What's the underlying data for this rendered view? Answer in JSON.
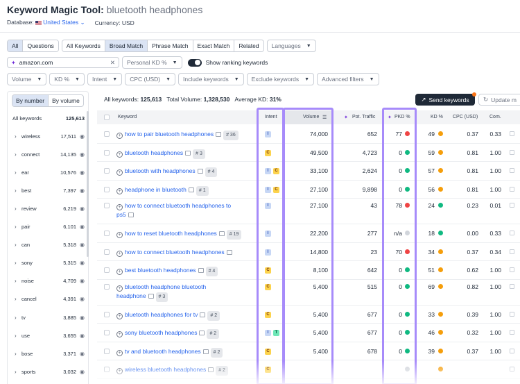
{
  "header": {
    "title": "Keyword Magic Tool:",
    "query": "bluetooth headphones",
    "database_label": "Database:",
    "database_value": "United States",
    "currency": "Currency: USD"
  },
  "match_tabs": [
    "All",
    "Questions"
  ],
  "match_types": [
    "All Keywords",
    "Broad Match",
    "Phrase Match",
    "Exact Match",
    "Related"
  ],
  "languages_placeholder": "Languages",
  "domain_input": {
    "value": "amazon.com"
  },
  "personal_kd": "Personal KD %",
  "show_ranking": "Show ranking keywords",
  "filters": [
    "Volume",
    "KD %",
    "Intent",
    "CPC (USD)",
    "Include keywords",
    "Exclude keywords",
    "Advanced filters"
  ],
  "panel": {
    "tab_number": "By number",
    "tab_volume": "By volume",
    "all_label": "All keywords",
    "all_count": "125,613",
    "items": [
      {
        "w": "wireless",
        "n": "17,511"
      },
      {
        "w": "connect",
        "n": "14,135"
      },
      {
        "w": "ear",
        "n": "10,576"
      },
      {
        "w": "best",
        "n": "7,397"
      },
      {
        "w": "review",
        "n": "6,219"
      },
      {
        "w": "pair",
        "n": "6,101"
      },
      {
        "w": "can",
        "n": "5,318"
      },
      {
        "w": "sony",
        "n": "5,315"
      },
      {
        "w": "noise",
        "n": "4,709"
      },
      {
        "w": "cancel",
        "n": "4,391"
      },
      {
        "w": "tv",
        "n": "3,885"
      },
      {
        "w": "use",
        "n": "3,655"
      },
      {
        "w": "bose",
        "n": "3,371"
      },
      {
        "w": "sports",
        "n": "3,032"
      }
    ]
  },
  "summary": {
    "all_label": "All keywords:",
    "all_value": "125,613",
    "vol_label": "Total Volume:",
    "vol_value": "1,328,530",
    "kd_label": "Average KD:",
    "kd_value": "31%"
  },
  "send_button": "Send keywords",
  "update_button": "Update m",
  "columns": {
    "keyword": "Keyword",
    "intent": "Intent",
    "volume": "Volume",
    "pot_traffic": "Pot. Traffic",
    "pkd": "PKD %",
    "kd": "KD %",
    "cpc": "CPC (USD)",
    "com": "Com."
  },
  "colors": {
    "accent_purple": "#a78bfa",
    "red": "#ef4444",
    "green": "#10b981",
    "orange": "#f59e0b",
    "gray": "#d1d5db"
  },
  "rows": [
    {
      "kw": [
        "how to pair bluetooth headphones"
      ],
      "tag": "36",
      "intent": [
        "I"
      ],
      "volume": "74,000",
      "pot": "652",
      "pkd": "77",
      "pkd_color": "#ef4444",
      "kd": "49",
      "kd_color": "#f59e0b",
      "cpc": "0.37",
      "com": "0.33"
    },
    {
      "kw": [
        "bluetooth headphones"
      ],
      "tag": "3",
      "intent": [
        "C"
      ],
      "volume": "49,500",
      "pot": "4,723",
      "pkd": "0",
      "pkd_color": "#10b981",
      "kd": "59",
      "kd_color": "#f59e0b",
      "cpc": "0.81",
      "com": "1.00"
    },
    {
      "kw": [
        "bluetooth with headphones"
      ],
      "tag": "4",
      "intent": [
        "I",
        "C"
      ],
      "volume": "33,100",
      "pot": "2,624",
      "pkd": "0",
      "pkd_color": "#10b981",
      "kd": "57",
      "kd_color": "#f59e0b",
      "cpc": "0.81",
      "com": "1.00"
    },
    {
      "kw": [
        "headphone in bluetooth"
      ],
      "tag": "1",
      "intent": [
        "I",
        "C"
      ],
      "volume": "27,100",
      "pot": "9,898",
      "pkd": "0",
      "pkd_color": "#10b981",
      "kd": "56",
      "kd_color": "#f59e0b",
      "cpc": "0.81",
      "com": "1.00"
    },
    {
      "kw": [
        "how to connect bluetooth headphones to",
        "ps5"
      ],
      "tag": "",
      "intent": [
        "I"
      ],
      "volume": "27,100",
      "pot": "43",
      "pkd": "78",
      "pkd_color": "#ef4444",
      "kd": "24",
      "kd_color": "#10b981",
      "cpc": "0.23",
      "com": "0.01"
    },
    {
      "kw": [
        "how to reset bluetooth headphones"
      ],
      "tag": "19",
      "intent": [
        "I"
      ],
      "volume": "22,200",
      "pot": "277",
      "pkd": "n/a",
      "pkd_color": "#d1d5db",
      "kd": "18",
      "kd_color": "#10b981",
      "cpc": "0.00",
      "com": "0.33"
    },
    {
      "kw": [
        "how to connect bluetooth headphones"
      ],
      "tag": "",
      "intent": [
        "I"
      ],
      "volume": "14,800",
      "pot": "23",
      "pkd": "70",
      "pkd_color": "#ef4444",
      "kd": "34",
      "kd_color": "#f59e0b",
      "cpc": "0.37",
      "com": "0.34"
    },
    {
      "kw": [
        "best bluetooth headphones"
      ],
      "tag": "4",
      "intent": [
        "C"
      ],
      "volume": "8,100",
      "pot": "642",
      "pkd": "0",
      "pkd_color": "#10b981",
      "kd": "51",
      "kd_color": "#f59e0b",
      "cpc": "0.62",
      "com": "1.00"
    },
    {
      "kw": [
        "bluetooth headphone bluetooth",
        "headphone"
      ],
      "tag": "3",
      "intent": [
        "C"
      ],
      "volume": "5,400",
      "pot": "515",
      "pkd": "0",
      "pkd_color": "#10b981",
      "kd": "69",
      "kd_color": "#f59e0b",
      "cpc": "0.82",
      "com": "1.00"
    },
    {
      "kw": [
        "bluetooth headphones for tv"
      ],
      "tag": "2",
      "intent": [
        "C"
      ],
      "volume": "5,400",
      "pot": "677",
      "pkd": "0",
      "pkd_color": "#10b981",
      "kd": "33",
      "kd_color": "#f59e0b",
      "cpc": "0.39",
      "com": "1.00"
    },
    {
      "kw": [
        "sony bluetooth headphones"
      ],
      "tag": "2",
      "intent": [
        "I",
        "T"
      ],
      "volume": "5,400",
      "pot": "677",
      "pkd": "0",
      "pkd_color": "#10b981",
      "kd": "46",
      "kd_color": "#f59e0b",
      "cpc": "0.32",
      "com": "1.00"
    },
    {
      "kw": [
        "tv and bluetooth headphones"
      ],
      "tag": "2",
      "intent": [
        "C"
      ],
      "volume": "5,400",
      "pot": "678",
      "pkd": "0",
      "pkd_color": "#10b981",
      "kd": "39",
      "kd_color": "#f59e0b",
      "cpc": "0.37",
      "com": "1.00"
    },
    {
      "kw": [
        "wireless bluetooth headphones"
      ],
      "tag": "2",
      "intent": [
        "C"
      ],
      "volume": "",
      "pot": "",
      "pkd": "",
      "pkd_color": "#d1d5db",
      "kd": "",
      "kd_color": "#f59e0b",
      "cpc": "",
      "com": ""
    }
  ]
}
